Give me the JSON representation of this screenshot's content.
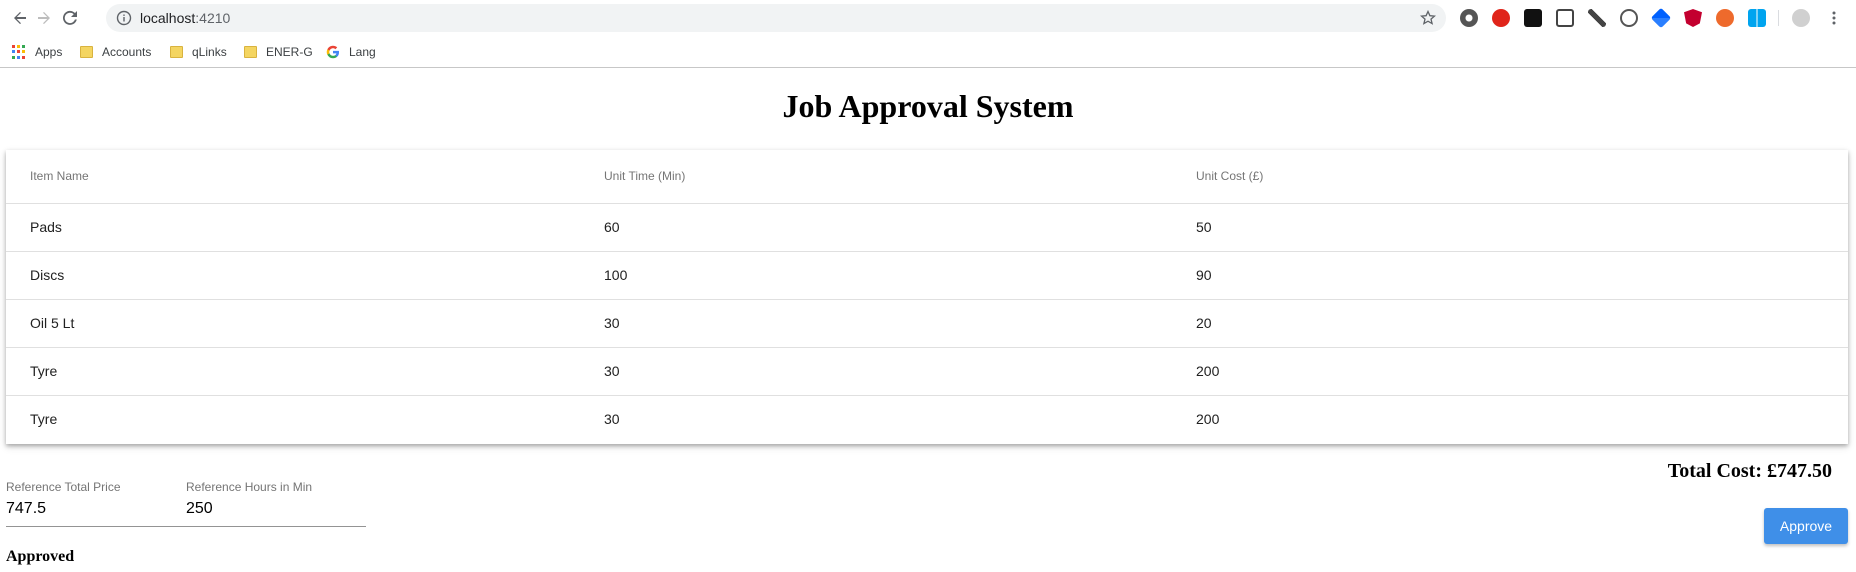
{
  "browser": {
    "url_host": "localhost",
    "url_port": ":4210",
    "bookmarks": [
      {
        "label": "Apps",
        "icon": "apps-grid-icon"
      },
      {
        "label": "Accounts",
        "icon": "folder-icon"
      },
      {
        "label": "qLinks",
        "icon": "folder-icon"
      },
      {
        "label": "ENER-G",
        "icon": "folder-icon"
      },
      {
        "label": "Lang",
        "icon": "google-icon"
      }
    ],
    "extensions": [
      "record-icon",
      "opera-icon",
      "jetbrains-icon",
      "screenshot-icon",
      "eyedropper-icon",
      "code-icon",
      "dropbox-icon",
      "angular-icon",
      "orange-ext-icon",
      "windows-icon",
      "profile-icon",
      "menu-icon"
    ]
  },
  "page": {
    "title": "Job Approval System",
    "table": {
      "columns": [
        "Item Name",
        "Unit Time (Min)",
        "Unit Cost (£)"
      ],
      "rows": [
        [
          "Pads",
          "60",
          "50"
        ],
        [
          "Discs",
          "100",
          "90"
        ],
        [
          "Oil 5 Lt",
          "30",
          "20"
        ],
        [
          "Tyre",
          "30",
          "200"
        ],
        [
          "Tyre",
          "30",
          "200"
        ]
      ]
    },
    "total_cost": "Total Cost: £747.50",
    "reference_price": {
      "label": "Reference Total Price",
      "value": "747.5"
    },
    "reference_hours": {
      "label": "Reference Hours in Min",
      "value": "250"
    },
    "approve_label": "Approve",
    "status": "Approved"
  },
  "colors": {
    "approve_button": "#3f8fe8",
    "omnibox": "#f1f3f4",
    "folder": "#f4d561"
  }
}
